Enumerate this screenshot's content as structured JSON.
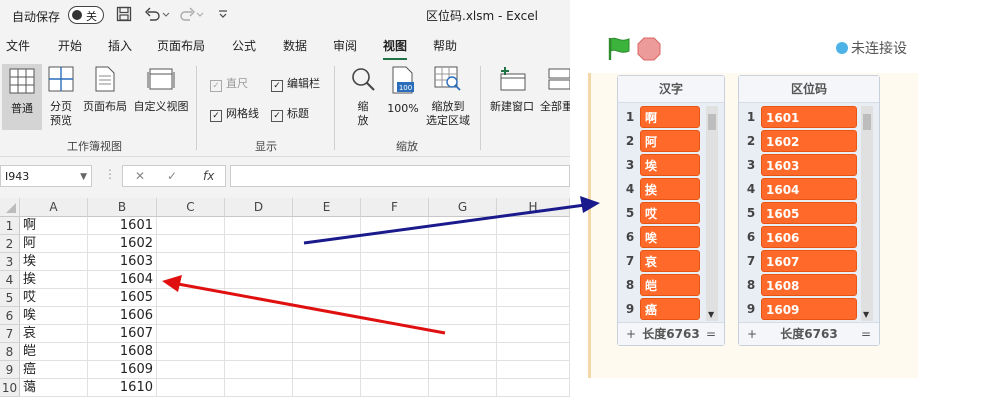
{
  "excel": {
    "autosave_label": "自动保存",
    "autosave_state": "关",
    "window_title": "区位码.xlsm  -  Excel",
    "menu_tabs": [
      "文件",
      "开始",
      "插入",
      "页面布局",
      "公式",
      "数据",
      "审阅",
      "视图",
      "帮助"
    ],
    "active_tab": "视图",
    "ribbon": {
      "normal": "普通",
      "page_break_1": "分页",
      "page_break_2": "预览",
      "page_layout": "页面布局",
      "custom_view": "自定义视图",
      "workbook_views_group": "工作簿视图",
      "ruler": "直尺",
      "formula_bar": "编辑栏",
      "gridlines": "网格线",
      "headings": "标题",
      "show_group": "显示",
      "zoom_1": "缩",
      "zoom_2": "放",
      "zoom100": "100%",
      "zoom_selection_1": "缩放到",
      "zoom_selection_2": "选定区域",
      "zoom_group": "缩放",
      "new_window": "新建窗口",
      "arrange_all": "全部重"
    },
    "namebox": "I943",
    "columns": [
      "A",
      "B",
      "C",
      "D",
      "E",
      "F",
      "G",
      "H"
    ],
    "rows": [
      {
        "n": "1",
        "a": "啊",
        "b": "1601"
      },
      {
        "n": "2",
        "a": "阿",
        "b": "1602"
      },
      {
        "n": "3",
        "a": "埃",
        "b": "1603"
      },
      {
        "n": "4",
        "a": "挨",
        "b": "1604"
      },
      {
        "n": "5",
        "a": "哎",
        "b": "1605"
      },
      {
        "n": "6",
        "a": "唉",
        "b": "1606"
      },
      {
        "n": "7",
        "a": "哀",
        "b": "1607"
      },
      {
        "n": "8",
        "a": "皑",
        "b": "1608"
      },
      {
        "n": "9",
        "a": "癌",
        "b": "1609"
      },
      {
        "n": "10",
        "a": "蔼",
        "b": "1610"
      }
    ]
  },
  "scratch": {
    "status": "未连接设",
    "list1": {
      "title": "汉字",
      "items": [
        "啊",
        "阿",
        "埃",
        "挨",
        "哎",
        "唉",
        "哀",
        "皑",
        "癌"
      ],
      "length_label": "长度6763"
    },
    "list2": {
      "title": "区位码",
      "items": [
        "1601",
        "1602",
        "1603",
        "1604",
        "1605",
        "1606",
        "1607",
        "1608",
        "1609"
      ],
      "length_label": "长度6763"
    },
    "footer_plus": "+",
    "footer_eq": "="
  },
  "colors": {
    "excel_green": "#217346",
    "list_item_orange": "#ff6a2a",
    "arrow_blue": "#1a1a8c",
    "arrow_red": "#e01010"
  },
  "icons": [
    "save-icon",
    "undo-icon",
    "redo-icon",
    "customize-icon",
    "green-flag-icon",
    "stop-icon",
    "status-dot-icon"
  ]
}
